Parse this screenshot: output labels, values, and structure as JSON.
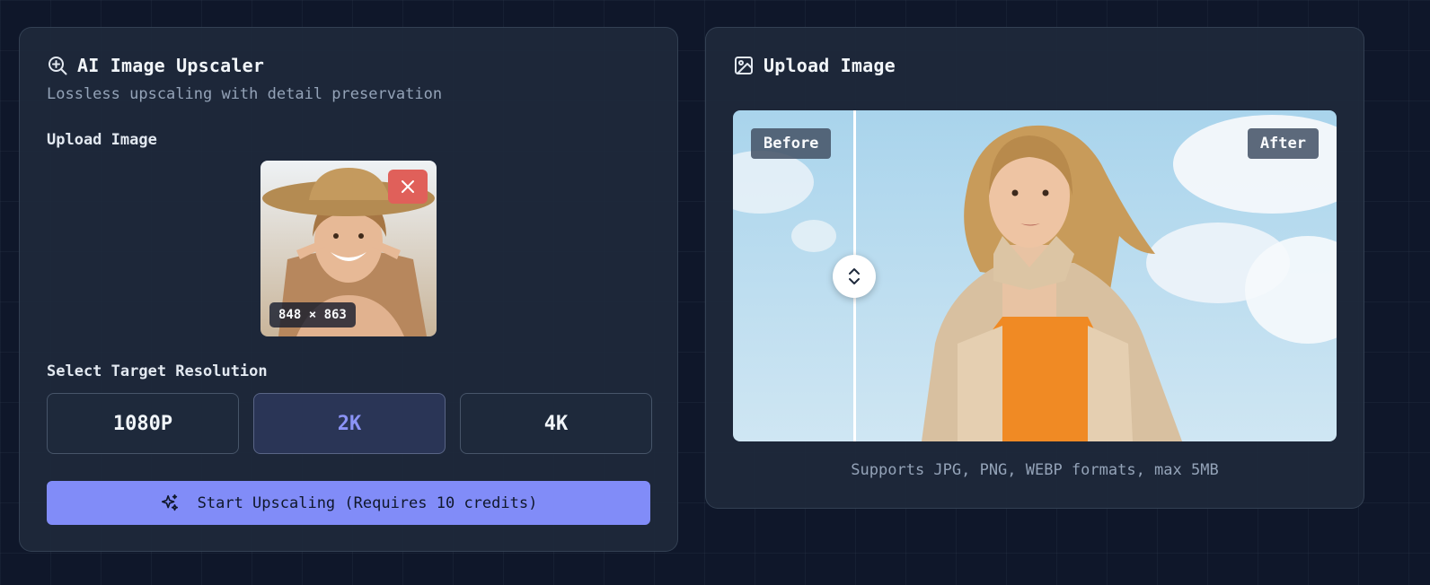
{
  "upscaler": {
    "title": "AI Image Upscaler",
    "subtitle": "Lossless upscaling with detail preservation",
    "upload_label": "Upload Image",
    "image_dimensions": "848 × 863",
    "resolution_label": "Select Target Resolution",
    "resolutions": [
      {
        "label": "1080P",
        "selected": false
      },
      {
        "label": "2K",
        "selected": true
      },
      {
        "label": "4K",
        "selected": false
      }
    ],
    "start_button": "Start Upscaling (Requires 10 credits)"
  },
  "preview": {
    "title": "Upload Image",
    "before_label": "Before",
    "after_label": "After",
    "slider_position": 0.2,
    "formats_note": "Supports JPG, PNG, WEBP formats, max 5MB"
  },
  "colors": {
    "background": "#0f172a",
    "panel": "#1e293b",
    "accent": "#818cf8",
    "close": "#e0605a"
  },
  "icons": {
    "upscaler": "zoom-in-icon",
    "preview": "image-icon",
    "close": "close-icon",
    "start": "sparkles-icon",
    "handle": "chevron-up-down-icon"
  }
}
